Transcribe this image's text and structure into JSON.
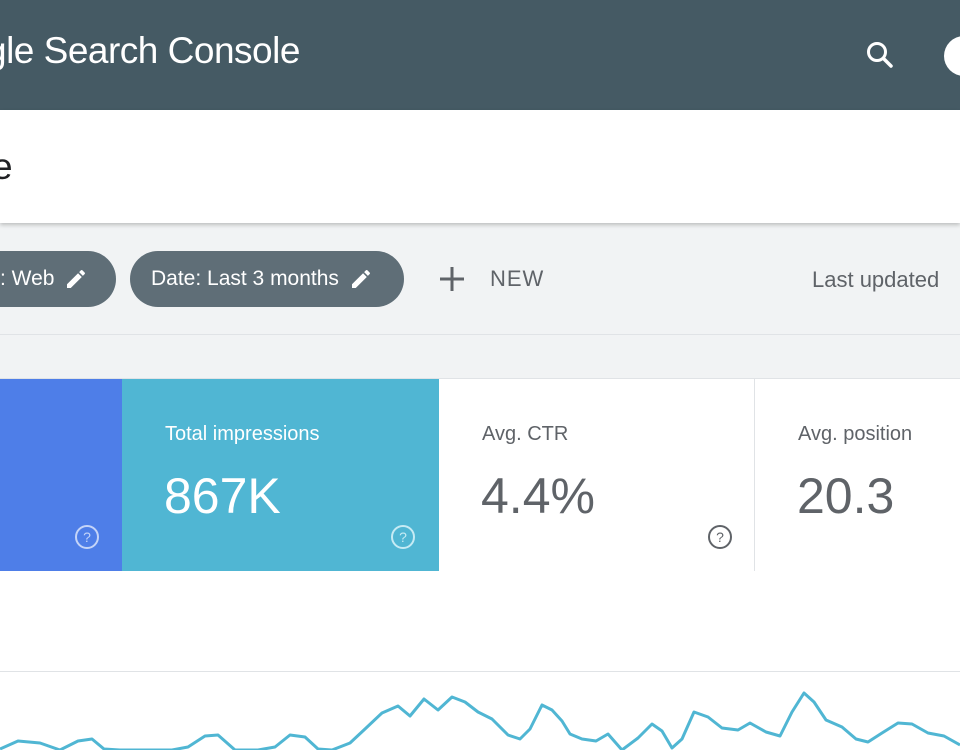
{
  "appbar": {
    "brand": "gle Search Console",
    "search_icon": "search-icon"
  },
  "page": {
    "title": "e"
  },
  "filters": {
    "type_chip": ": Web",
    "date_chip": "Date: Last 3 months",
    "new_label": "NEW",
    "last_updated": "Last updated"
  },
  "metrics": {
    "impressions_label": "Total impressions",
    "impressions_value": "867K",
    "ctr_label": "Avg. CTR",
    "ctr_value": "4.4%",
    "position_label": "Avg. position",
    "position_value": "20.3"
  },
  "colors": {
    "appbar": "#455a64",
    "clicks": "#4e7ee8",
    "impressions": "#50b6d3",
    "chip": "#5f6e77"
  }
}
